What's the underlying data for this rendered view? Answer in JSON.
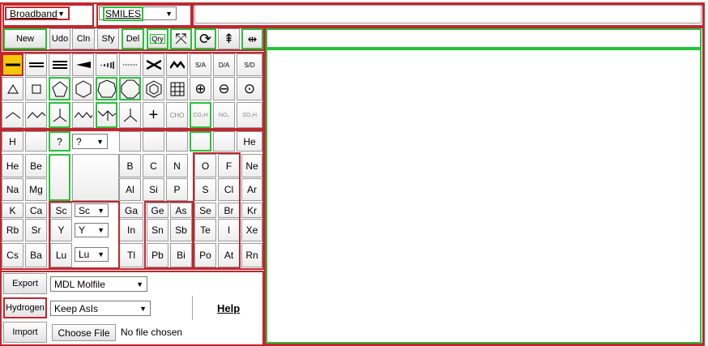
{
  "top": {
    "broadband_label": "Broadband",
    "format_label": "SMILES",
    "smiles_input": ""
  },
  "toolbar": {
    "new": "New",
    "undo": "Udo",
    "clean": "Cln",
    "simplify": "Sfy",
    "delete": "Del",
    "query": "Qry"
  },
  "bond_row": {
    "sa": "S/A",
    "da": "D/A",
    "sd": "S/D"
  },
  "fragments": {
    "cho": "CHO",
    "co2h": "CO₂H",
    "no2": "NO₂",
    "so3h": "SO₃H"
  },
  "elements": {
    "row1": [
      "H",
      "",
      "?",
      "?",
      "",
      "",
      "",
      "",
      "",
      "",
      "He"
    ],
    "row2": [
      "He",
      "Be",
      "",
      "",
      "B",
      "C",
      "N",
      "O",
      "F",
      "Ne"
    ],
    "row3": [
      "Na",
      "Mg",
      "",
      "",
      "Al",
      "Si",
      "P",
      "S",
      "Cl",
      "Ar"
    ],
    "row4": [
      "K",
      "Ca",
      "Sc",
      "Sc",
      "Ga",
      "Ge",
      "As",
      "Se",
      "Br",
      "Kr"
    ],
    "row5": [
      "Rb",
      "Sr",
      "Y",
      "Y",
      "In",
      "Sn",
      "Sb",
      "Te",
      "I",
      "Xe"
    ],
    "row6": [
      "Cs",
      "Ba",
      "Lu",
      "Lu",
      "Tl",
      "Pb",
      "Bi",
      "Po",
      "At",
      "Rn"
    ]
  },
  "bottom": {
    "export_button": "Export",
    "export_format": "MDL Molfile",
    "hydrogen_button": "Hydrogen",
    "hydrogen_option": "Keep AsIs",
    "help_link": "Help",
    "import_button": "Import",
    "choose_file": "Choose File",
    "no_file": "No file chosen"
  }
}
